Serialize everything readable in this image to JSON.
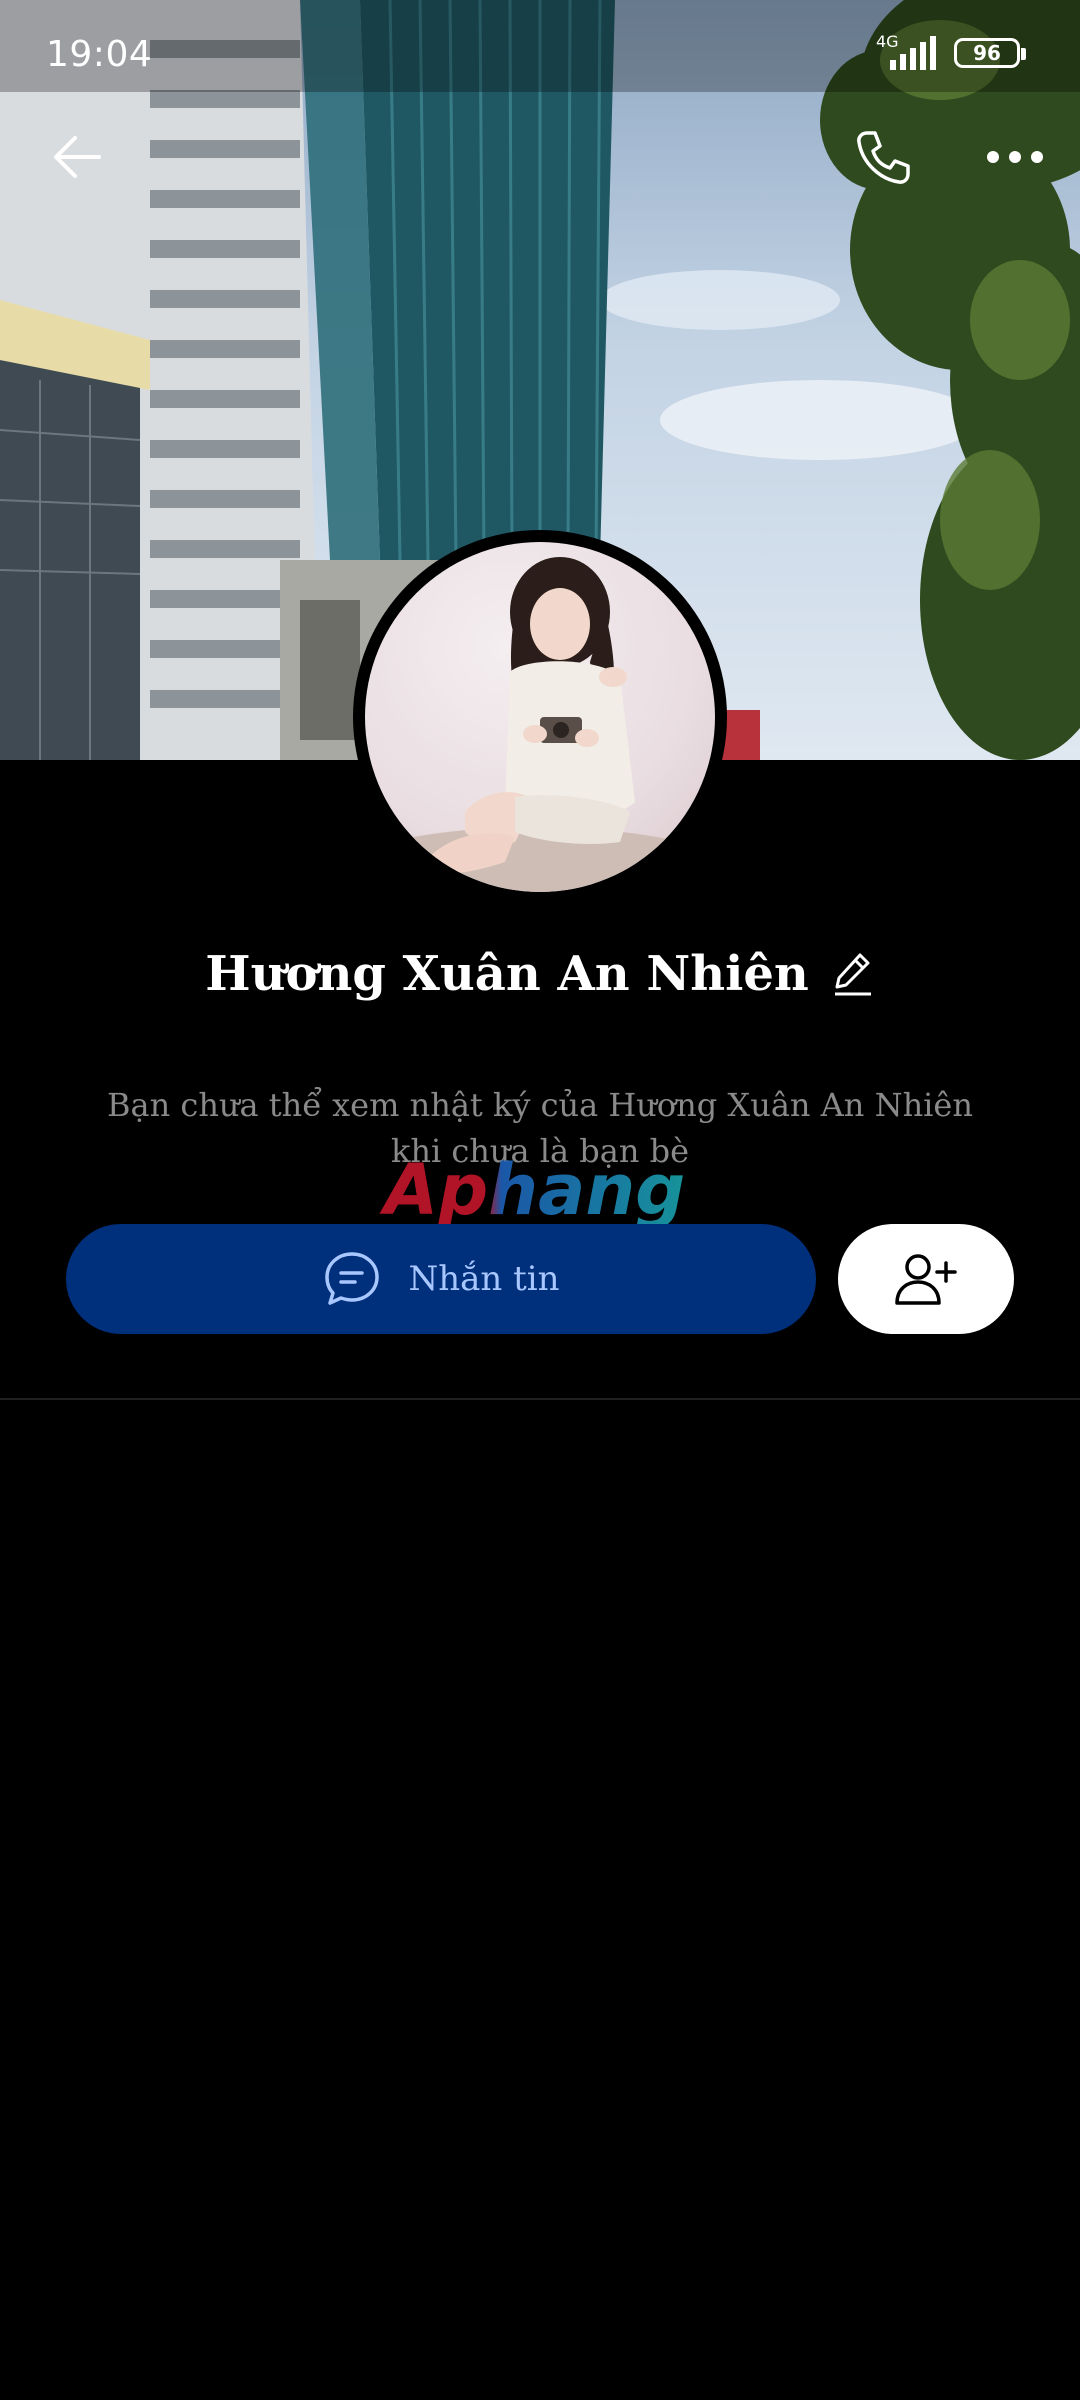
{
  "status_bar": {
    "time": "19:04",
    "network": "4G",
    "battery": "96"
  },
  "header": {
    "back_icon": "arrow-left-icon",
    "call_icon": "phone-icon",
    "more_icon": "more-horizontal-icon"
  },
  "profile": {
    "name": "Hương Xuân An Nhiên",
    "edit_icon": "pencil-icon",
    "notice": "Bạn chưa thể xem nhật ký của Hương Xuân An Nhiên khi chưa là bạn bè"
  },
  "watermark": "Aphang",
  "actions": {
    "message_label": "Nhắn tin",
    "message_icon": "chat-bubble-icon",
    "add_friend_icon": "add-user-icon"
  },
  "colors": {
    "background": "#000000",
    "message_button": "#002f7b",
    "message_text": "#a9c7ff",
    "notice_text": "#8a8a8a"
  }
}
